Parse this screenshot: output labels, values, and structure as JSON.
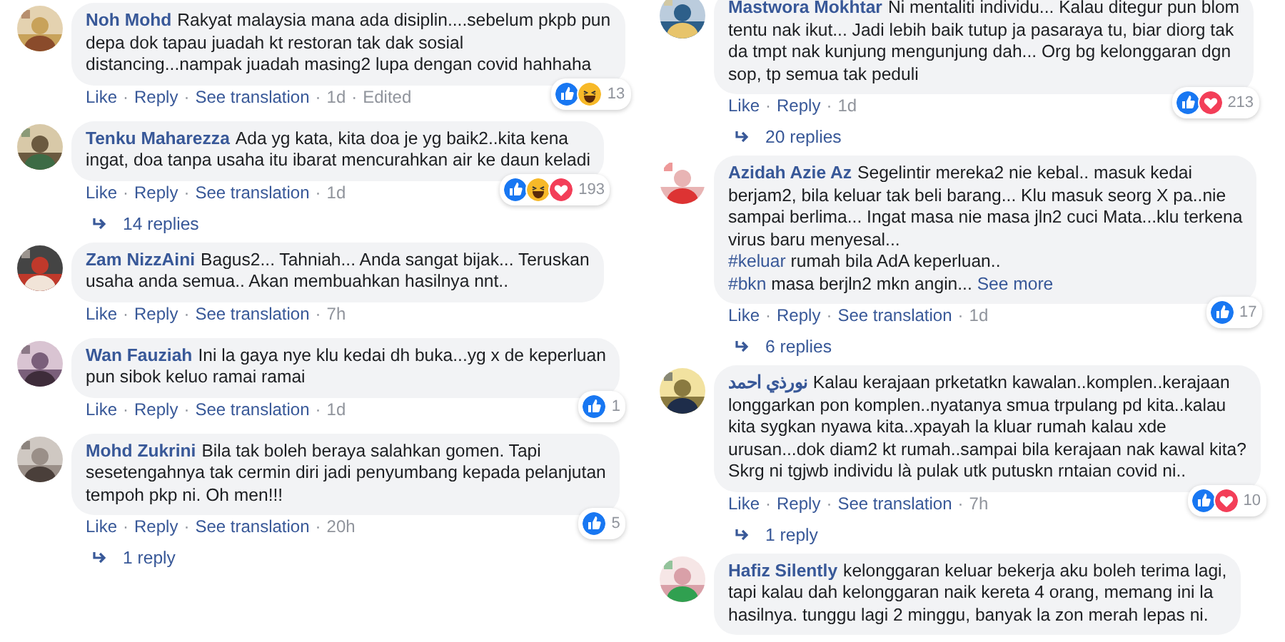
{
  "separator": "·",
  "columns": [
    {
      "comments": [
        {
          "author": "Noh Mohd",
          "body": [
            {
              "kind": "text",
              "text": "Rakyat malaysia mana ada disiplin....sebelum pkpb pun\ndepa dok tapau juadah kt restoran tak dak sosial\ndistancing...nampak juadah masing2 lupa dengan covid hahhaha"
            }
          ],
          "reactions": {
            "like": true,
            "haha": true,
            "love": false,
            "count": "13"
          },
          "actions": [
            "Like",
            "Reply",
            "See translation"
          ],
          "time": "1d",
          "edited": "Edited"
        },
        {
          "author": "Tenku Maharezza",
          "body": [
            {
              "kind": "text",
              "text": "Ada yg kata, kita doa je yg baik2..kita kena\ningat, doa tanpa usaha itu ibarat mencurahkan air ke daun keladi"
            }
          ],
          "reactions": {
            "like": true,
            "haha": true,
            "love": true,
            "count": "193"
          },
          "actions": [
            "Like",
            "Reply",
            "See translation"
          ],
          "time": "1d",
          "replies": "14 replies"
        },
        {
          "author": "Zam NizzAini",
          "body": [
            {
              "kind": "text",
              "text": "Bagus2... Tahniah... Anda sangat bijak... Teruskan\nusaha anda semua.. Akan membuahkan hasilnya nnt.."
            }
          ],
          "actions": [
            "Like",
            "Reply",
            "See translation"
          ],
          "time": "7h"
        },
        {
          "author": "Wan Fauziah",
          "body": [
            {
              "kind": "text",
              "text": "Ini la gaya nye klu kedai dh buka...yg x de keperluan\npun sibok keluo ramai ramai"
            }
          ],
          "reactions": {
            "like": true,
            "haha": false,
            "love": false,
            "count": "1"
          },
          "actions": [
            "Like",
            "Reply",
            "See translation"
          ],
          "time": "1d"
        },
        {
          "author": "Mohd Zukrini",
          "body": [
            {
              "kind": "text",
              "text": "Bila tak boleh beraya salahkan gomen. Tapi\nsesetengahnya tak cermin diri jadi penyumbang kepada pelanjutan\ntempoh pkp ni. Oh men!!!"
            }
          ],
          "reactions": {
            "like": true,
            "haha": false,
            "love": false,
            "count": "5"
          },
          "actions": [
            "Like",
            "Reply",
            "See translation"
          ],
          "time": "20h",
          "replies": "1 reply"
        }
      ]
    },
    {
      "comments": [
        {
          "author": "Mastwora Mokhtar",
          "body": [
            {
              "kind": "text",
              "text": "Ni mentaliti individu... Kalau ditegur pun blom\ntentu nak ikut... Jadi lebih baik tutup ja pasaraya tu, biar diorg tak\nda tmpt nak kunjung mengunjung dah... Org bg kelonggaran dgn\nsop, tp semua tak peduli"
            }
          ],
          "reactions": {
            "like": true,
            "haha": false,
            "love": true,
            "count": "213"
          },
          "actions": [
            "Like",
            "Reply"
          ],
          "time": "1d",
          "replies": "20 replies"
        },
        {
          "author": "Azidah Azie Az",
          "body": [
            {
              "kind": "text",
              "text": "Segelintir mereka2 nie kebal.. masuk kedai\nberjam2, bila keluar tak beli barang... Klu masuk seorg X pa..nie\nsampai berlima... Ingat masa nie masa jln2 cuci Mata...klu terkena\nvirus baru menyesal...\n"
            },
            {
              "kind": "hashtag",
              "text": "#keluar"
            },
            {
              "kind": "text",
              "text": " rumah bila AdA keperluan..\n"
            },
            {
              "kind": "hashtag",
              "text": "#bkn"
            },
            {
              "kind": "text",
              "text": " masa berjln2 mkn angin... "
            },
            {
              "kind": "more",
              "text": "See more"
            }
          ],
          "reactions": {
            "like": true,
            "haha": false,
            "love": false,
            "count": "17"
          },
          "actions": [
            "Like",
            "Reply",
            "See translation"
          ],
          "time": "1d",
          "replies": "6 replies"
        },
        {
          "author": "نورذي احمد",
          "body": [
            {
              "kind": "text",
              "text": "Kalau kerajaan prketatkn kawalan..komplen..kerajaan\nlonggarkan pon komplen..nyatanya smua trpulang pd kita..kalau\nkita sygkan nyawa kita..xpayah la kluar rumah kalau xde\nurusan...dok diam2 kt rumah..sampai bila kerajaan nak kawal kita?\nSkrg ni tgjwb individu là pulak utk putuskn rntaian covid ni.."
            }
          ],
          "reactions": {
            "like": true,
            "haha": false,
            "love": true,
            "count": "10"
          },
          "actions": [
            "Like",
            "Reply",
            "See translation"
          ],
          "time": "7h",
          "replies": "1 reply"
        },
        {
          "author": "Hafiz Silently",
          "body": [
            {
              "kind": "text",
              "text": "kelonggaran keluar bekerja aku boleh terima lagi,\ntapi kalau dah kelonggaran naik kereta 4 orang, memang ini la\nhasilnya. tunggu lagi 2 minggu, banyak la zon merah lepas ni."
            }
          ]
        }
      ]
    }
  ]
}
